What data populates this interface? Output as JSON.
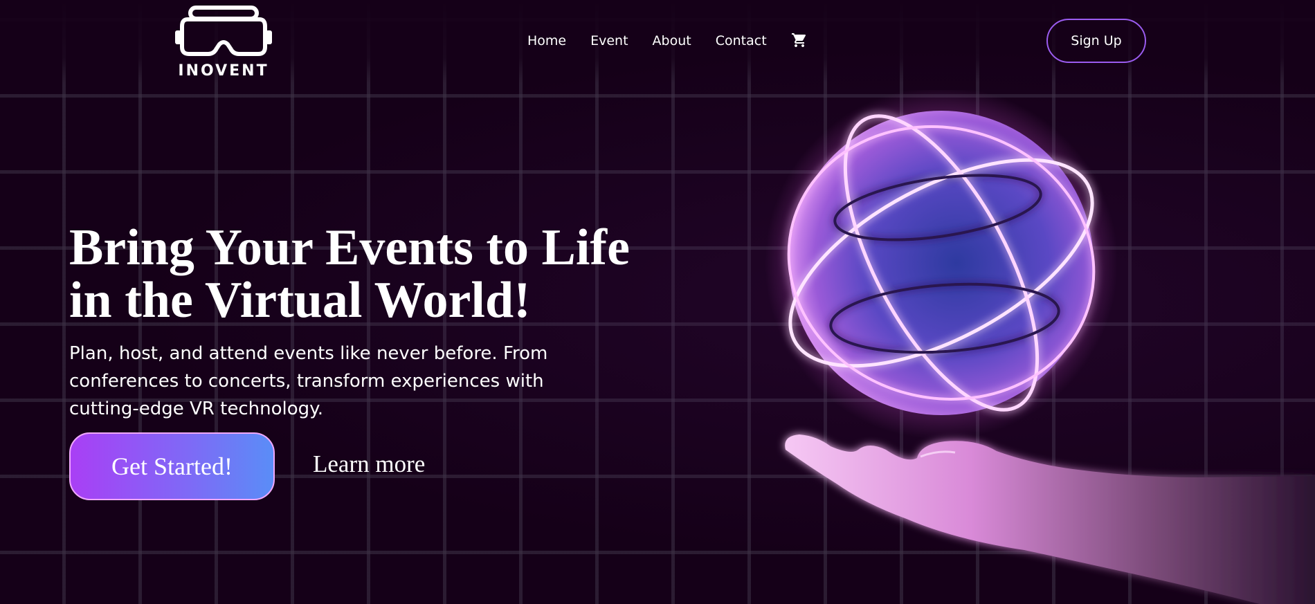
{
  "brand": {
    "name": "INOVENT",
    "logo_icon": "vr-headset-icon"
  },
  "nav": {
    "links": [
      "Home",
      "Event",
      "About",
      "Contact"
    ],
    "cart_icon": "cart-icon",
    "signup_label": "Sign Up"
  },
  "hero": {
    "title_lines": [
      "Bring Your Events to Life",
      "in the Virtual World!"
    ],
    "subtitle_lines": [
      "Plan, host, and attend events like never before. From",
      "conferences to concerts, transform experiences with",
      "cutting-edge VR technology."
    ],
    "primary_cta": "Get Started!",
    "secondary_cta": "Learn more",
    "illustration": "glowing-globe-over-hand"
  },
  "colors": {
    "background": "#150018",
    "grid": "#3e3246",
    "accent_purple": "#a93ff5",
    "accent_blue": "#5a8df7",
    "signup_border": "#9b5cf0"
  }
}
